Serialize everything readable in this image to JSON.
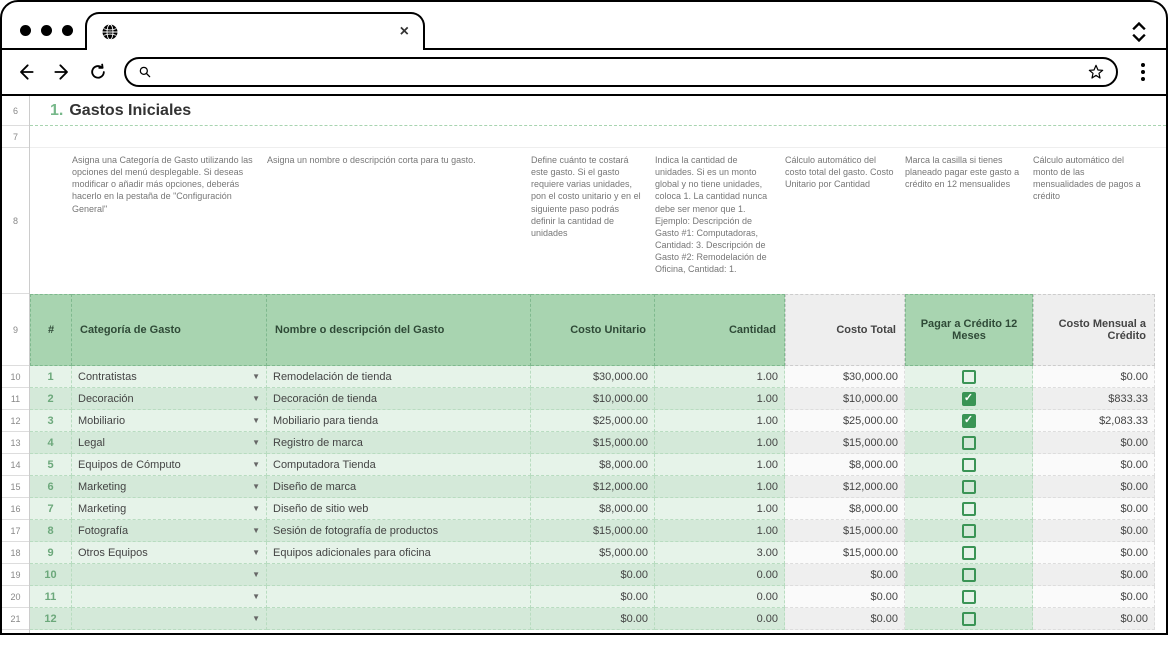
{
  "section": {
    "number": "1.",
    "title": "Gastos Iniciales"
  },
  "row_numbers_visible": [
    "6",
    "7",
    "8",
    "9",
    "10",
    "11",
    "12",
    "13",
    "14",
    "15",
    "16",
    "17",
    "18",
    "19",
    "20",
    "21"
  ],
  "descriptions": {
    "categoria": "Asigna una Categoría de Gasto utilizando las opciones del menú desplegable. Si deseas modificar o añadir más opciones, deberás hacerlo en la pestaña de \"Configuración General\"",
    "nombre": "Asigna un nombre o descripción corta para tu gasto.",
    "costo_unitario": "Define cuánto te costará este gasto. Si el gasto requiere varias unidades, pon el costo unitario y en el siguiente paso podrás definir la cantidad de unidades",
    "cantidad": "Indica la cantidad de unidades. Si es un monto global y no tiene unidades, coloca 1. La cantidad nunca debe ser menor que 1. Ejemplo: Descripción de Gasto #1: Computadoras, Cantidad: 3. Descripción de Gasto #2: Remodelación de Oficina, Cantidad: 1.",
    "costo_total": "Cálculo automático del costo total del gasto. Costo Unitario por Cantidad",
    "pagar_credito": "Marca la casilla si tienes planeado pagar este gasto a crédito en 12 mensualides",
    "costo_mensual": "Cálculo automático del monto de las mensualidades de pagos a crédito"
  },
  "headers": {
    "idx": "#",
    "categoria": "Categoría de Gasto",
    "nombre": "Nombre o descripción del Gasto",
    "costo_unitario": "Costo Unitario",
    "cantidad": "Cantidad",
    "costo_total": "Costo Total",
    "pagar_credito": "Pagar a Crédito 12 Meses",
    "costo_mensual": "Costo Mensual a Crédito"
  },
  "rows": [
    {
      "n": "1",
      "cat": "Contratistas",
      "name": "Remodelación de tienda",
      "cost": "$30,000.00",
      "qty": "1.00",
      "total": "$30,000.00",
      "credit": false,
      "monthly": "$0.00"
    },
    {
      "n": "2",
      "cat": "Decoración",
      "name": "Decoración de tienda",
      "cost": "$10,000.00",
      "qty": "1.00",
      "total": "$10,000.00",
      "credit": true,
      "monthly": "$833.33"
    },
    {
      "n": "3",
      "cat": "Mobiliario",
      "name": "Mobiliario para tienda",
      "cost": "$25,000.00",
      "qty": "1.00",
      "total": "$25,000.00",
      "credit": true,
      "monthly": "$2,083.33"
    },
    {
      "n": "4",
      "cat": "Legal",
      "name": "Registro de marca",
      "cost": "$15,000.00",
      "qty": "1.00",
      "total": "$15,000.00",
      "credit": false,
      "monthly": "$0.00"
    },
    {
      "n": "5",
      "cat": "Equipos de Cómputo",
      "name": "Computadora Tienda",
      "cost": "$8,000.00",
      "qty": "1.00",
      "total": "$8,000.00",
      "credit": false,
      "monthly": "$0.00"
    },
    {
      "n": "6",
      "cat": "Marketing",
      "name": "Diseño de marca",
      "cost": "$12,000.00",
      "qty": "1.00",
      "total": "$12,000.00",
      "credit": false,
      "monthly": "$0.00"
    },
    {
      "n": "7",
      "cat": "Marketing",
      "name": "Diseño de sitio web",
      "cost": "$8,000.00",
      "qty": "1.00",
      "total": "$8,000.00",
      "credit": false,
      "monthly": "$0.00"
    },
    {
      "n": "8",
      "cat": "Fotografía",
      "name": "Sesión de fotografía de productos",
      "cost": "$15,000.00",
      "qty": "1.00",
      "total": "$15,000.00",
      "credit": false,
      "monthly": "$0.00"
    },
    {
      "n": "9",
      "cat": "Otros Equipos",
      "name": "Equipos adicionales para oficina",
      "cost": "$5,000.00",
      "qty": "3.00",
      "total": "$15,000.00",
      "credit": false,
      "monthly": "$0.00"
    },
    {
      "n": "10",
      "cat": "",
      "name": "",
      "cost": "$0.00",
      "qty": "0.00",
      "total": "$0.00",
      "credit": false,
      "monthly": "$0.00"
    },
    {
      "n": "11",
      "cat": "",
      "name": "",
      "cost": "$0.00",
      "qty": "0.00",
      "total": "$0.00",
      "credit": false,
      "monthly": "$0.00"
    },
    {
      "n": "12",
      "cat": "",
      "name": "",
      "cost": "$0.00",
      "qty": "0.00",
      "total": "$0.00",
      "credit": false,
      "monthly": "$0.00"
    }
  ]
}
